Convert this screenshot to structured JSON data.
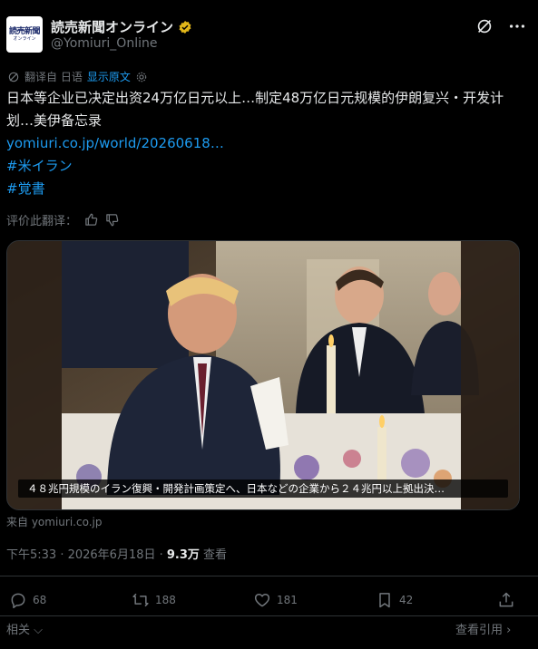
{
  "account": {
    "avatar_line1": "読売新聞",
    "avatar_line2": "オンライン",
    "name": "読売新聞オンライン",
    "handle": "@Yomiuri_Online"
  },
  "translation": {
    "label": "翻译自 日语",
    "show_original": "显示原文"
  },
  "post": {
    "text": "日本等企业已决定出资24万亿日元以上…制定48万亿日元规模的伊朗复兴・开发计划…美伊备忘录",
    "link": "yomiuri.co.jp/world/20260618…",
    "hashtag1": "#米イラン",
    "hashtag2": "#覚書"
  },
  "rate": {
    "label": "评价此翻译："
  },
  "media": {
    "caption": "４８兆円規模のイラン復興・開発計画策定へ、日本などの企業から２４兆円以上拠出決…"
  },
  "source": "来自 yomiuri.co.jp",
  "meta": {
    "time": "下午5:33 · 2026年6月18日 · ",
    "views": "9.3万",
    "views_label": " 查看"
  },
  "actions": {
    "replies": "68",
    "reposts": "188",
    "likes": "181",
    "bookmarks": "42"
  },
  "footer": {
    "related": "相关",
    "quotes": "查看引用"
  },
  "colors": {
    "background": "#000000",
    "text": "#e7e9ea",
    "secondary": "#71767b",
    "link": "#1d9bf0",
    "verified": "#e2b719"
  }
}
